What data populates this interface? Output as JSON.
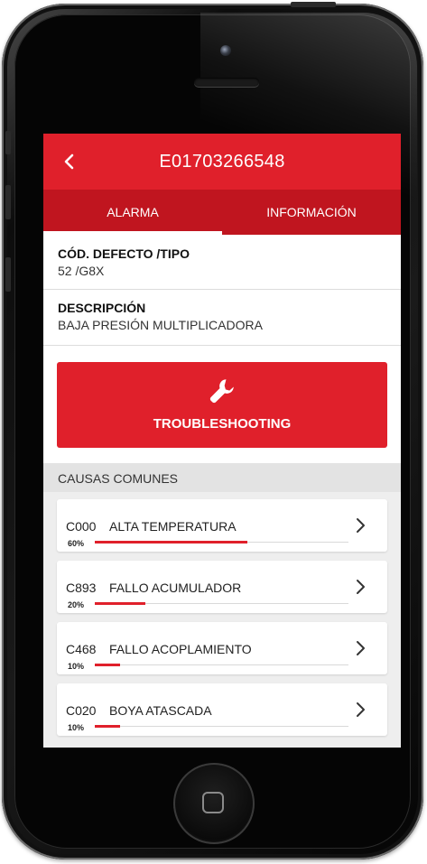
{
  "header": {
    "title": "E01703266548"
  },
  "tabs": [
    {
      "label": "ALARMA",
      "active": true
    },
    {
      "label": "INFORMACIÓN",
      "active": false
    }
  ],
  "defect": {
    "label": "CÓD. DEFECTO  /TIPO",
    "value": "52 /G8X"
  },
  "description": {
    "label": "DESCRIPCIÓN",
    "value": "BAJA PRESIÓN MULTIPLICADORA"
  },
  "troubleshooting": {
    "label": "TROUBLESHOOTING",
    "icon": "wrench-icon"
  },
  "causes_section": {
    "title": "CAUSAS COMUNES"
  },
  "causes": [
    {
      "code": "C000",
      "name": "ALTA TEMPERATURA",
      "pct_label": "60%",
      "pct": 60
    },
    {
      "code": "C893",
      "name": "FALLO ACUMULADOR",
      "pct_label": "20%",
      "pct": 20
    },
    {
      "code": "C468",
      "name": "FALLO ACOPLAMIENTO",
      "pct_label": "10%",
      "pct": 10
    },
    {
      "code": "C020",
      "name": "BOYA ATASCADA",
      "pct_label": "10%",
      "pct": 10
    }
  ],
  "colors": {
    "accent": "#e0202b",
    "accent_dark": "#c0151f"
  }
}
